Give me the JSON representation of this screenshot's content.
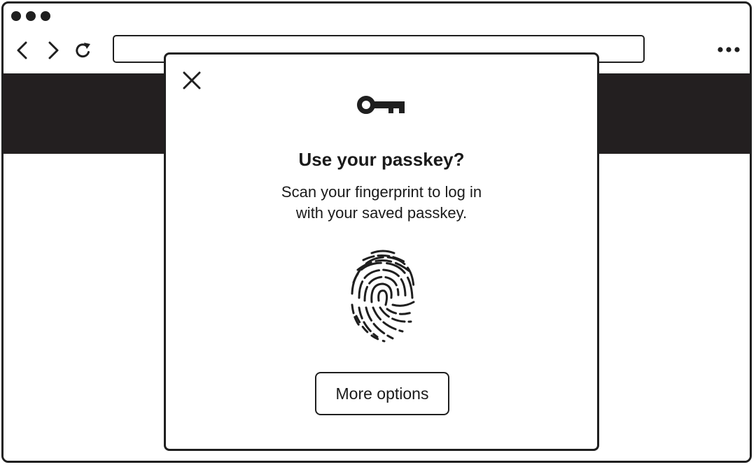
{
  "browser": {
    "address_bar": {
      "value": ""
    },
    "icons": {
      "back": "chevron-left-icon",
      "forward": "chevron-right-icon",
      "reload": "reload-icon",
      "menu": "more-horizontal-icon",
      "window_controls": "window-dot-icon"
    }
  },
  "dialog": {
    "close_icon": "close-icon",
    "key_icon": "key-icon",
    "title": "Use your passkey?",
    "body_line1": "Scan your fingerprint to log in",
    "body_line2": "with your saved passkey.",
    "fingerprint_icon": "fingerprint-icon",
    "more_options_label": "More options"
  },
  "colors": {
    "ink": "#1f1f1f",
    "hero_band": "#231f20",
    "background": "#ffffff"
  }
}
